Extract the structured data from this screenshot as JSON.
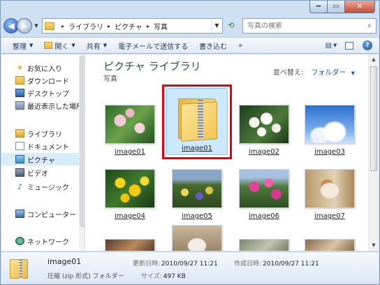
{
  "window": {
    "min_label": "━",
    "max_label": "▭",
    "close_label": "✕"
  },
  "address": {
    "crumbs": [
      "ライブラリ",
      "ピクチャ",
      "写真"
    ],
    "separator": "▸"
  },
  "search": {
    "placeholder": "写真の検索"
  },
  "commands": {
    "organize": "整理",
    "open": "開く",
    "share": "共有",
    "email": "電子メールで送信する",
    "burn": "書き込む",
    "more": "»"
  },
  "nav": {
    "favorites": "お気に入り",
    "downloads": "ダウンロード",
    "desktop": "デスクトップ",
    "recent": "最近表示した場所",
    "libraries": "ライブラリ",
    "documents": "ドキュメント",
    "pictures": "ピクチャ",
    "videos": "ビデオ",
    "music": "ミュージック",
    "computer": "コンピューター",
    "network": "ネットワーク"
  },
  "content": {
    "title": "ピクチャ ライブラリ",
    "subtitle": "写真",
    "sort_label": "並べ替え:",
    "sort_value": "フォルダー",
    "items": [
      {
        "label": "image01"
      },
      {
        "label": "image01"
      },
      {
        "label": "image02"
      },
      {
        "label": "image03"
      },
      {
        "label": "image04"
      },
      {
        "label": "image05"
      },
      {
        "label": "image06"
      },
      {
        "label": "image07"
      }
    ]
  },
  "details": {
    "name": "image01",
    "type": "圧縮 (zip 形式) フォルダー",
    "modified_label": "更新日時:",
    "modified_value": "2010/09/27 11:21",
    "created_label": "作成日時:",
    "created_value": "2010/09/27 11:21",
    "size_label": "サイズ:",
    "size_value": "497 KB"
  },
  "colors": {
    "accent": "#1a5bb8",
    "highlight": "#e60012",
    "title_green": "#1e5a36"
  }
}
